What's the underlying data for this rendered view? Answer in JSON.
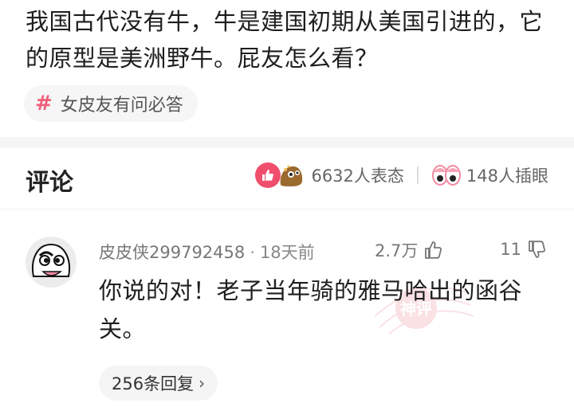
{
  "post": {
    "text": "我国古代没有牛，牛是建国初期从美国引进的，它的原型是美洲野牛。屁友怎么看？",
    "tag": {
      "hash": "#",
      "label": "女皮友有问必答"
    }
  },
  "comments_header": {
    "title": "评论",
    "reaction_count": "6632人表态",
    "eye_count": "148人插眼"
  },
  "comment": {
    "username": "皮皮侠299792458",
    "separator": "·",
    "time": "18天前",
    "like_count": "2.7万",
    "dislike_count": "11",
    "text": "你说的对！老子当年骑的雅马哈出的函谷关。",
    "reply_label": "256条回复",
    "reply_chevron": "›",
    "stamp_label": "神评"
  },
  "colors": {
    "accent": "#ef4f6c",
    "tag_hash": "#f0607a",
    "stamp": "#f7c9cf"
  },
  "icons": [
    "thumbs-up-icon",
    "sticker-icon",
    "eyes-icon",
    "like-icon",
    "dislike-icon",
    "stamp-icon",
    "chevron-right-icon"
  ]
}
